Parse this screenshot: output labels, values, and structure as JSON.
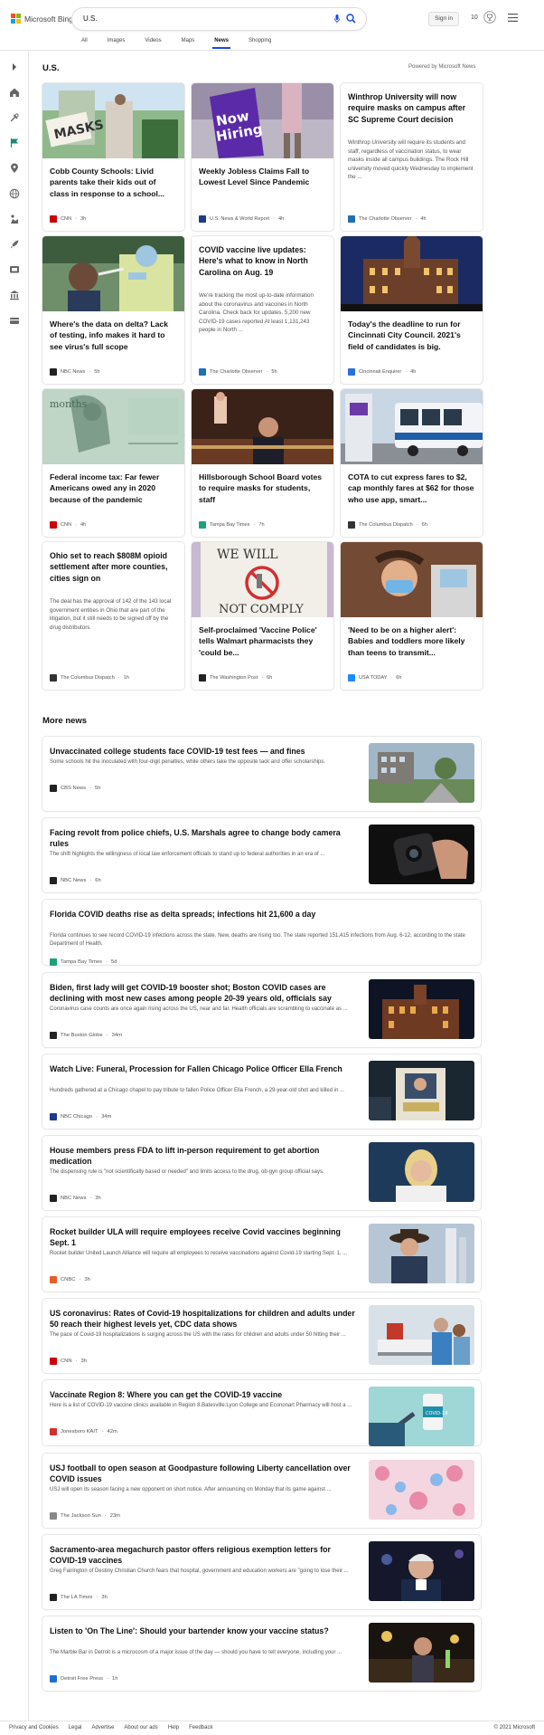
{
  "header": {
    "brand": "Microsoft Bing",
    "search_value": "U.S.",
    "signin_label": "Sign in",
    "rewards_count": "10",
    "brand_colors": [
      "#f25022",
      "#7fba00",
      "#00a4ef",
      "#ffb900"
    ],
    "accent": "#174ae4"
  },
  "tabs": [
    {
      "label": "All"
    },
    {
      "label": "Images"
    },
    {
      "label": "Videos"
    },
    {
      "label": "Maps"
    },
    {
      "label": "News",
      "active": true
    },
    {
      "label": "Shopping"
    }
  ],
  "rail_icons": [
    "chevron-right-icon",
    "home-icon",
    "tools-icon",
    "flag-icon",
    "location-pin-icon",
    "globe-icon",
    "scale-icon",
    "rocket-icon",
    "tv-icon",
    "bank-icon",
    "wallet-icon"
  ],
  "section": {
    "title": "U.S.",
    "powered": "Powered by Microsoft News"
  },
  "cards": [
    {
      "title": "Cobb County Schools: Livid parents take their kids out of class in response to a school...",
      "source": "CNN",
      "time": "3h",
      "logo_color": "#cc0000",
      "image": "protest-masks"
    },
    {
      "title": "Weekly Jobless Claims Fall to Lowest Level Since Pandemic",
      "source": "U.S. News & World Report",
      "time": "4h",
      "logo_color": "#1f3c88",
      "image": "now-hiring"
    },
    {
      "title": "Winthrop University will now require masks on campus after SC Supreme Court decision",
      "abstract": "Winthrop University will require its students and staff, regardless of vaccination status, to wear masks inside all campus buildings. The Rock Hill university moved quickly Wednesday to implement the ...",
      "source": "The Charlotte Observer",
      "time": "4h",
      "logo_color": "#1e6fb5"
    },
    {
      "title": "Where's the data on delta? Lack of testing, info makes it hard to see virus's full scope",
      "source": "NBC News",
      "time": "5h",
      "logo_color": "#222",
      "image": "covid-testing"
    },
    {
      "title": "COVID vaccine live updates: Here's what to know in North Carolina on Aug. 19",
      "abstract": "We're tracking the most up-to-date information about the coronavirus and vaccines in North Carolina. Check back for updates. 5,200 new COVID-19 cases reported At least 1,131,243 people in North ...",
      "source": "The Charlotte Observer",
      "time": "5h",
      "logo_color": "#1e6fb5"
    },
    {
      "title": "Today's the deadline to run for Cincinnati City Council. 2021's field of candidates is big.",
      "source": "Cincinnati Enquirer",
      "time": "4h",
      "logo_color": "#2a6fdb",
      "image": "city-hall"
    },
    {
      "title": "Federal income tax: Far fewer Americans owed any in 2020 because of the pandemic",
      "source": "CNN",
      "time": "4h",
      "logo_color": "#cc0000",
      "image": "tax-check"
    },
    {
      "title": "Hillsborough School Board votes to require masks for students, staff",
      "source": "Tampa Bay Times",
      "time": "7h",
      "logo_color": "#1aa37a",
      "image": "school-board"
    },
    {
      "title": "COTA to cut express fares to $2, cap monthly fares at $62 for those who use app, smart...",
      "source": "The Columbus Dispatch",
      "time": "6h",
      "logo_color": "#333",
      "image": "bus"
    },
    {
      "title": "Ohio set to reach $808M opioid settlement after more counties, cities sign on",
      "abstract": "The deal has the approval of 142 of the 143 local government entities in Ohio that are part of the litigation, but it still needs to be signed off by the drug distributors.",
      "source": "The Columbus Dispatch",
      "time": "1h",
      "logo_color": "#333"
    },
    {
      "title": "Self-proclaimed 'Vaccine Police' tells Walmart pharmacists they 'could be...",
      "source": "The Washington Post",
      "time": "6h",
      "logo_color": "#222",
      "image": "not-comply"
    },
    {
      "title": "'Need to be on a higher alert': Babies and toddlers more likely than teens to transmit...",
      "source": "USA TODAY",
      "time": "6h",
      "logo_color": "#1a8cff",
      "image": "toddler"
    }
  ],
  "more_news": {
    "title": "More news",
    "items": [
      {
        "title": "Unvaccinated college students face COVID-19 test fees — and fines",
        "abstract": "Some schools hit the inoculated with four-digit penalties, while others take the opposite tack and offer scholarships.",
        "source": "CBS News",
        "time": "5h",
        "logo_color": "#222",
        "image": "campus"
      },
      {
        "title": "Facing revolt from police chiefs, U.S. Marshals agree to change body camera rules",
        "abstract": "The shift highlights the willingness of local law enforcement officials to stand up to federal authorities in an era of ...",
        "source": "NBC News",
        "time": "6h",
        "logo_color": "#222",
        "image": "body-camera"
      },
      {
        "title": "Florida COVID deaths rise as delta spreads; infections hit 21,600 a day",
        "abstract": "Florida continues to see record COVID-19 infections across the state. New, deaths are rising too. The state reported 151,415 infections from Aug. 6-12, according to the state Department of Health.",
        "source": "Tampa Bay Times",
        "time": "5d",
        "logo_color": "#1aa37a"
      },
      {
        "title": "Biden, first lady will get COVID-19 booster shot; Boston COVID cases are declining with most new cases among people 20-39 years old, officials say",
        "abstract": "Coronavirus case counts are once again rising across the US, near and far. Health officials are scrambling to vaccinate as ...",
        "source": "The Boston Globe",
        "time": "34m",
        "logo_color": "#222",
        "image": "night-hall"
      },
      {
        "title": "Watch Live: Funeral, Procession for Fallen Chicago Police Officer Ella French",
        "abstract": "Hundreds gathered at a Chicago chapel to pay tribute to fallen Police Officer Ella French, a 29-year-old shot and killed in ...",
        "source": "NBC Chicago",
        "time": "34m",
        "logo_color": "#1e3a8a",
        "image": "memorial"
      },
      {
        "title": "House members press FDA to lift in-person requirement to get abortion medication",
        "abstract": "The dispensing rule is \"not scientifically based or needed\" and limits access to the drug, ob-gyn group official says.",
        "source": "NBC News",
        "time": "3h",
        "logo_color": "#222",
        "image": "portrait-blonde"
      },
      {
        "title": "Rocket builder ULA will require employees receive Covid vaccines beginning Sept. 1",
        "abstract": "Rocket builder United Launch Alliance will require all employees to receive vaccinations against Covid-19 starting Sept. 1, ...",
        "source": "CNBC",
        "time": "3h",
        "logo_color": "#e85d2a",
        "image": "rocket-man"
      },
      {
        "title": "US coronavirus: Rates of Covid-19 hospitalizations for children and adults under 50 reach their highest levels yet, CDC data shows",
        "abstract": "The pace of Covid-19 hospitalizations is surging across the US with the rates for children and adults under 50 hitting their ...",
        "source": "CNN",
        "time": "3h",
        "logo_color": "#cc0000",
        "image": "hospital"
      },
      {
        "title": "Vaccinate Region 8: Where you can get the COVID-19 vaccine",
        "abstract": "Here is a list of COVID-19 vaccine clinics available in Region 8.Batesville:Lyon College and Econonart Pharmacy will host a ...",
        "source": "Jonesboro KAIT",
        "time": "42m",
        "logo_color": "#d32f2f",
        "image": "vaccine-vial"
      },
      {
        "title": "USJ football to open season at Goodpasture following Liberty cancellation over COVID issues",
        "abstract": "USJ will open its season facing a new opponent on short notice. After announcing on Monday that its game against ...",
        "source": "The Jackson Sun",
        "time": "23m",
        "logo_color": "#888",
        "image": "pattern"
      },
      {
        "title": "Sacramento-area megachurch pastor offers religious exemption letters for COVID-19 vaccines",
        "abstract": "Greg Fairington of Destiny Christian Church fears that hospital, government and education workers are \"going to lose their ...",
        "source": "The LA Times",
        "time": "3h",
        "logo_color": "#222",
        "image": "pastor"
      },
      {
        "title": "Listen to 'On The Line': Should your bartender know your vaccine status?",
        "abstract": "The Marble Bar in Detroit is a microcosm of a major issue of the day — should you have to tell everyone, including your ...",
        "source": "Detroit Free Press",
        "time": "1h",
        "logo_color": "#1f6fd1",
        "image": "bar-night"
      }
    ]
  },
  "footer": {
    "links": [
      "Privacy and Cookies",
      "Legal",
      "Advertise",
      "About our ads",
      "Help",
      "Feedback"
    ],
    "copyright": "© 2021 Microsoft"
  }
}
